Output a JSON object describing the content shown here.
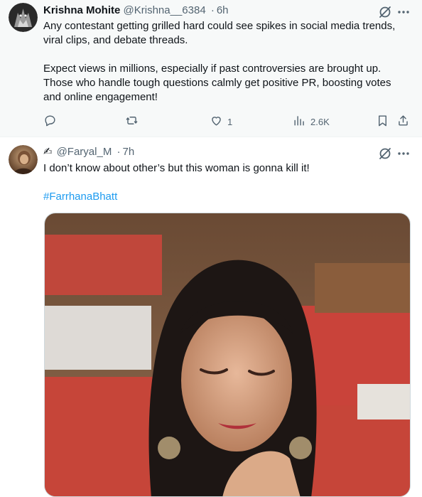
{
  "tweets": [
    {
      "author_name": "Krishna Mohite",
      "handle": "@Krishna__6384",
      "separator": "·",
      "time": "6h",
      "text_lines": [
        "Any contestant getting grilled hard could see spikes in social media trends,",
        "viral clips, and debate threads.",
        "",
        "Expect views in millions, especially if past controversies are brought up.",
        "Those who handle tough questions calmly get positive PR, boosting votes",
        "and online engagement!"
      ],
      "actions": {
        "reply_count": "",
        "retweet_count": "",
        "like_count": "1",
        "views_count": "2.6K"
      }
    },
    {
      "author_emoji": "✍",
      "handle": "@Faryal_M",
      "separator": "·",
      "time": "7h",
      "text": "I don’t know about other’s but this woman is gonna kill it!",
      "hashtag": "#FarrhanaBhatt"
    }
  ],
  "icons": {
    "grok": "grok-icon",
    "more": "more-icon",
    "reply": "reply-icon",
    "retweet": "retweet-icon",
    "like": "heart-icon",
    "views": "views-icon",
    "bookmark": "bookmark-icon",
    "share": "share-icon"
  },
  "colors": {
    "link": "#1d9bf0",
    "secondary_text": "#536471",
    "primary_text": "#0f1419",
    "highlighted_background": "#f7f9f9"
  }
}
